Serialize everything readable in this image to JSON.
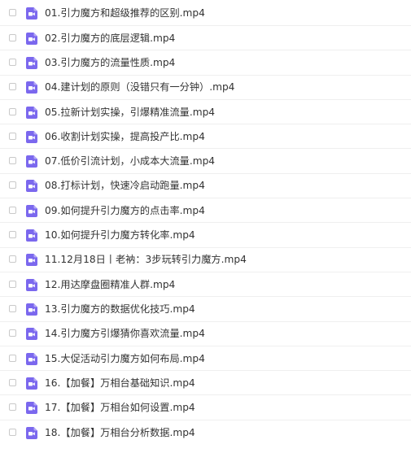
{
  "colors": {
    "icon_bg": "#7b68ee",
    "text": "#333333",
    "divider": "#efefef",
    "checkbox_border": "#c9c9c9"
  },
  "icon": "video-file-icon",
  "files": [
    {
      "name": "01.引力魔方和超级推荐的区别.mp4"
    },
    {
      "name": "02.引力魔方的底层逻辑.mp4"
    },
    {
      "name": "03.引力魔方的流量性质.mp4"
    },
    {
      "name": "04.建计划的原则（没错只有一分钟）.mp4"
    },
    {
      "name": "05.拉新计划实操，引爆精准流量.mp4"
    },
    {
      "name": "06.收割计划实操，提高投产比.mp4"
    },
    {
      "name": "07.低价引流计划，小成本大流量.mp4"
    },
    {
      "name": "08.打标计划，快速冷启动跑量.mp4"
    },
    {
      "name": "09.如何提升引力魔方的点击率.mp4"
    },
    {
      "name": "10.如何提升引力魔方转化率.mp4"
    },
    {
      "name": "11.12月18日丨老衲：3步玩转引力魔方.mp4"
    },
    {
      "name": "12.用达摩盘圈精准人群.mp4"
    },
    {
      "name": "13.引力魔方的数据优化技巧.mp4"
    },
    {
      "name": "14.引力魔方引爆猜你喜欢流量.mp4"
    },
    {
      "name": "15.大促活动引力魔方如何布局.mp4"
    },
    {
      "name": "16.【加餐】万相台基础知识.mp4"
    },
    {
      "name": "17.【加餐】万相台如何设置.mp4"
    },
    {
      "name": "18.【加餐】万相台分析数据.mp4"
    }
  ]
}
